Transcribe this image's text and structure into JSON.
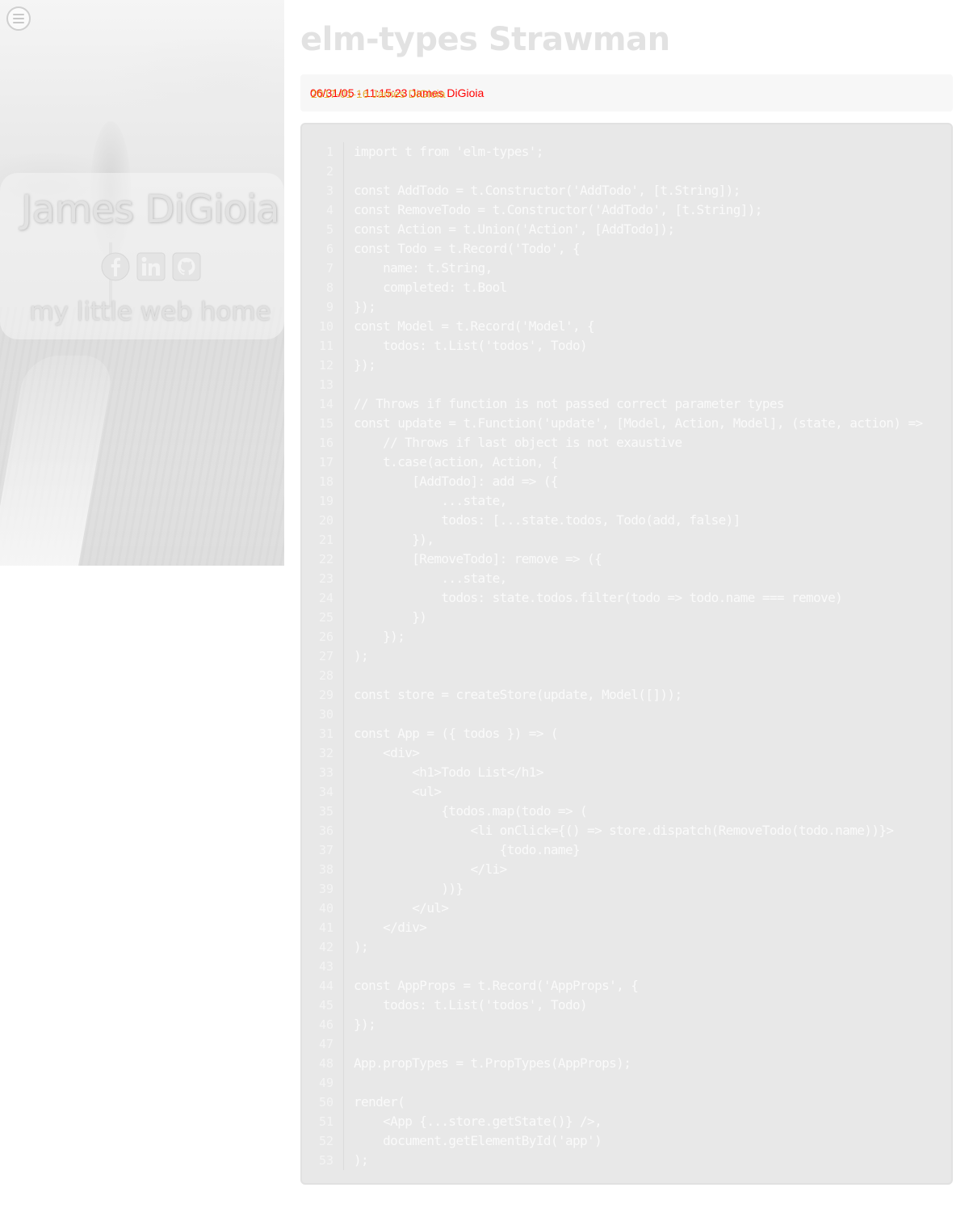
{
  "menu": {
    "icon": "hamburger-menu-icon"
  },
  "hero": {
    "name": "James DiGioia",
    "tagline": "my little web home",
    "socials": [
      {
        "icon": "facebook-icon"
      },
      {
        "icon": "linkedin-icon"
      },
      {
        "icon": "github-icon"
      }
    ]
  },
  "article": {
    "title": "elm-types Strawman",
    "meta_line_1": "06/31/05 - 11:15:23 James DiGioia",
    "meta_line_2": "2017-01-16 James DiGioia"
  },
  "code": {
    "lines": [
      "import t from 'elm-types';",
      "",
      "const AddTodo = t.Constructor('AddTodo', [t.String]);",
      "const RemoveTodo = t.Constructor('AddTodo', [t.String]);",
      "const Action = t.Union('Action', [AddTodo]);",
      "const Todo = t.Record('Todo', {",
      "    name: t.String,",
      "    completed: t.Bool",
      "});",
      "const Model = t.Record('Model', {",
      "    todos: t.List('todos', Todo)",
      "});",
      "",
      "// Throws if function is not passed correct parameter types",
      "const update = t.Function('update', [Model, Action, Model], (state, action) =>",
      "    // Throws if last object is not exaustive",
      "    t.case(action, Action, {",
      "        [AddTodo]: add => ({",
      "            ...state,",
      "            todos: [...state.todos, Todo(add, false)]",
      "        }),",
      "        [RemoveTodo]: remove => ({",
      "            ...state,",
      "            todos: state.todos.filter(todo => todo.name === remove)",
      "        })",
      "    });",
      ");",
      "",
      "const store = createStore(update, Model([]));",
      "",
      "const App = ({ todos }) => (",
      "    <div>",
      "        <h1>Todo List</h1>",
      "        <ul>",
      "            {todos.map(todo => (",
      "                <li onClick={() => store.dispatch(RemoveTodo(todo.name))}>",
      "                    {todo.name}",
      "                </li>",
      "            ))}",
      "        </ul>",
      "    </div>",
      ");",
      "",
      "const AppProps = t.Record('AppProps', {",
      "    todos: t.List('todos', Todo)",
      "});",
      "",
      "App.propTypes = t.PropTypes(AppProps);",
      "",
      "render(",
      "    <App {...store.getState()} />,",
      "    document.getElementById('app')",
      ");"
    ]
  }
}
